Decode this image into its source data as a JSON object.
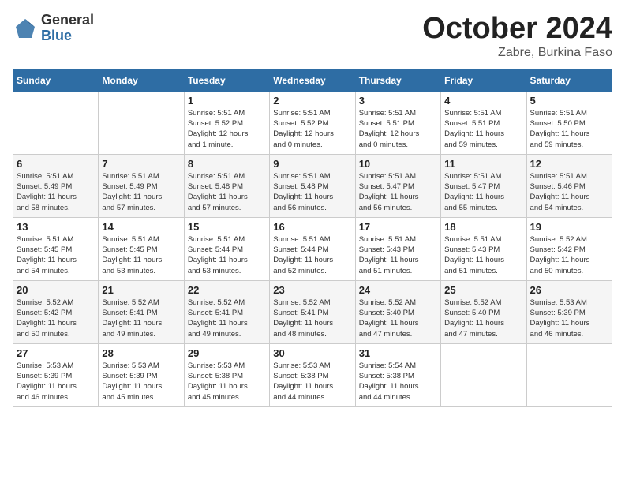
{
  "header": {
    "logo_general": "General",
    "logo_blue": "Blue",
    "month_title": "October 2024",
    "location": "Zabre, Burkina Faso"
  },
  "days_of_week": [
    "Sunday",
    "Monday",
    "Tuesday",
    "Wednesday",
    "Thursday",
    "Friday",
    "Saturday"
  ],
  "weeks": [
    [
      {
        "day": "",
        "info": ""
      },
      {
        "day": "",
        "info": ""
      },
      {
        "day": "1",
        "info": "Sunrise: 5:51 AM\nSunset: 5:52 PM\nDaylight: 12 hours\nand 1 minute."
      },
      {
        "day": "2",
        "info": "Sunrise: 5:51 AM\nSunset: 5:52 PM\nDaylight: 12 hours\nand 0 minutes."
      },
      {
        "day": "3",
        "info": "Sunrise: 5:51 AM\nSunset: 5:51 PM\nDaylight: 12 hours\nand 0 minutes."
      },
      {
        "day": "4",
        "info": "Sunrise: 5:51 AM\nSunset: 5:51 PM\nDaylight: 11 hours\nand 59 minutes."
      },
      {
        "day": "5",
        "info": "Sunrise: 5:51 AM\nSunset: 5:50 PM\nDaylight: 11 hours\nand 59 minutes."
      }
    ],
    [
      {
        "day": "6",
        "info": "Sunrise: 5:51 AM\nSunset: 5:49 PM\nDaylight: 11 hours\nand 58 minutes."
      },
      {
        "day": "7",
        "info": "Sunrise: 5:51 AM\nSunset: 5:49 PM\nDaylight: 11 hours\nand 57 minutes."
      },
      {
        "day": "8",
        "info": "Sunrise: 5:51 AM\nSunset: 5:48 PM\nDaylight: 11 hours\nand 57 minutes."
      },
      {
        "day": "9",
        "info": "Sunrise: 5:51 AM\nSunset: 5:48 PM\nDaylight: 11 hours\nand 56 minutes."
      },
      {
        "day": "10",
        "info": "Sunrise: 5:51 AM\nSunset: 5:47 PM\nDaylight: 11 hours\nand 56 minutes."
      },
      {
        "day": "11",
        "info": "Sunrise: 5:51 AM\nSunset: 5:47 PM\nDaylight: 11 hours\nand 55 minutes."
      },
      {
        "day": "12",
        "info": "Sunrise: 5:51 AM\nSunset: 5:46 PM\nDaylight: 11 hours\nand 54 minutes."
      }
    ],
    [
      {
        "day": "13",
        "info": "Sunrise: 5:51 AM\nSunset: 5:45 PM\nDaylight: 11 hours\nand 54 minutes."
      },
      {
        "day": "14",
        "info": "Sunrise: 5:51 AM\nSunset: 5:45 PM\nDaylight: 11 hours\nand 53 minutes."
      },
      {
        "day": "15",
        "info": "Sunrise: 5:51 AM\nSunset: 5:44 PM\nDaylight: 11 hours\nand 53 minutes."
      },
      {
        "day": "16",
        "info": "Sunrise: 5:51 AM\nSunset: 5:44 PM\nDaylight: 11 hours\nand 52 minutes."
      },
      {
        "day": "17",
        "info": "Sunrise: 5:51 AM\nSunset: 5:43 PM\nDaylight: 11 hours\nand 51 minutes."
      },
      {
        "day": "18",
        "info": "Sunrise: 5:51 AM\nSunset: 5:43 PM\nDaylight: 11 hours\nand 51 minutes."
      },
      {
        "day": "19",
        "info": "Sunrise: 5:52 AM\nSunset: 5:42 PM\nDaylight: 11 hours\nand 50 minutes."
      }
    ],
    [
      {
        "day": "20",
        "info": "Sunrise: 5:52 AM\nSunset: 5:42 PM\nDaylight: 11 hours\nand 50 minutes."
      },
      {
        "day": "21",
        "info": "Sunrise: 5:52 AM\nSunset: 5:41 PM\nDaylight: 11 hours\nand 49 minutes."
      },
      {
        "day": "22",
        "info": "Sunrise: 5:52 AM\nSunset: 5:41 PM\nDaylight: 11 hours\nand 49 minutes."
      },
      {
        "day": "23",
        "info": "Sunrise: 5:52 AM\nSunset: 5:41 PM\nDaylight: 11 hours\nand 48 minutes."
      },
      {
        "day": "24",
        "info": "Sunrise: 5:52 AM\nSunset: 5:40 PM\nDaylight: 11 hours\nand 47 minutes."
      },
      {
        "day": "25",
        "info": "Sunrise: 5:52 AM\nSunset: 5:40 PM\nDaylight: 11 hours\nand 47 minutes."
      },
      {
        "day": "26",
        "info": "Sunrise: 5:53 AM\nSunset: 5:39 PM\nDaylight: 11 hours\nand 46 minutes."
      }
    ],
    [
      {
        "day": "27",
        "info": "Sunrise: 5:53 AM\nSunset: 5:39 PM\nDaylight: 11 hours\nand 46 minutes."
      },
      {
        "day": "28",
        "info": "Sunrise: 5:53 AM\nSunset: 5:39 PM\nDaylight: 11 hours\nand 45 minutes."
      },
      {
        "day": "29",
        "info": "Sunrise: 5:53 AM\nSunset: 5:38 PM\nDaylight: 11 hours\nand 45 minutes."
      },
      {
        "day": "30",
        "info": "Sunrise: 5:53 AM\nSunset: 5:38 PM\nDaylight: 11 hours\nand 44 minutes."
      },
      {
        "day": "31",
        "info": "Sunrise: 5:54 AM\nSunset: 5:38 PM\nDaylight: 11 hours\nand 44 minutes."
      },
      {
        "day": "",
        "info": ""
      },
      {
        "day": "",
        "info": ""
      }
    ]
  ]
}
